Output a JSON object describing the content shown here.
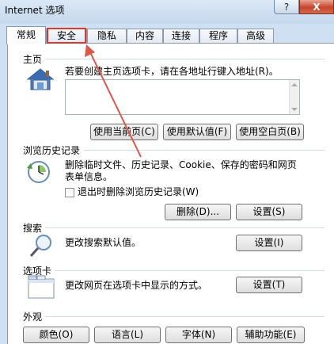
{
  "window": {
    "title": "Internet 选项",
    "help_label": "?",
    "close_label": "X"
  },
  "tabs": [
    "常规",
    "安全",
    "隐私",
    "内容",
    "连接",
    "程序",
    "高级"
  ],
  "active_tab": "常规",
  "highlighted_tab": "安全",
  "homepage": {
    "section_label": "主页",
    "hint": "若要创建主页选项卡，请在各地址行键入地址(R)。",
    "address_value": "",
    "use_current_button": "使用当前页(C)",
    "use_default_button": "使用默认值(F)",
    "use_blank_button": "使用空白页(B)"
  },
  "history": {
    "section_label": "浏览历史记录",
    "description": "删除临时文件、历史记录、Cookie、保存的密码和网页表单信息。",
    "delete_on_exit_label": "退出时删除浏览历史记录(W)",
    "delete_on_exit_checked": false,
    "delete_button": "删除(D)...",
    "settings_button": "设置(S)"
  },
  "search": {
    "section_label": "搜索",
    "description": "更改搜索默认值。",
    "settings_button": "设置(I)"
  },
  "tabs_section": {
    "section_label": "选项卡",
    "description": "更改网页在选项卡中显示的方式。",
    "settings_button": "设置(T)"
  },
  "appearance": {
    "section_label": "外观",
    "colors_button": "颜色(O)",
    "languages_button": "语言(L)",
    "fonts_button": "字体(N)",
    "accessibility_button": "辅助功能(E)"
  },
  "annotation_colors": {
    "highlight": "#d83a32",
    "arrow": "#d8584c"
  },
  "icons": [
    "house-icon",
    "history-clock-icon",
    "magnifier-search-icon",
    "tabbed-window-icon"
  ]
}
